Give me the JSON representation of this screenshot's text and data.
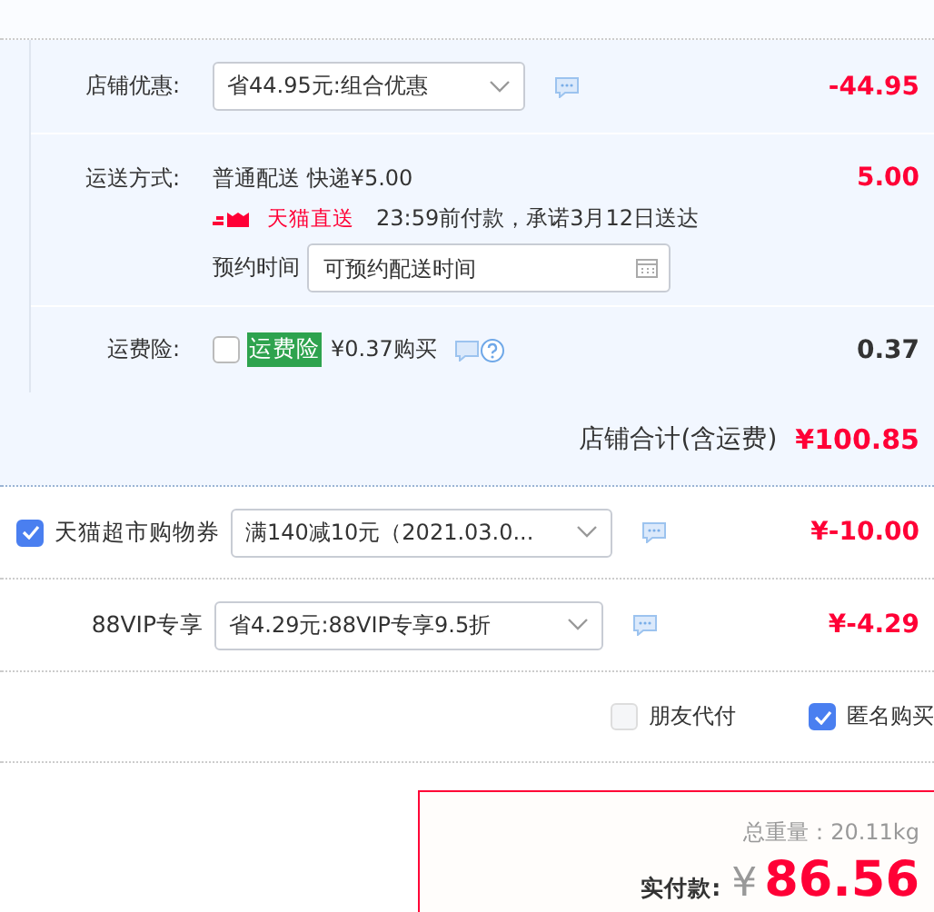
{
  "store_discount": {
    "label": "店铺优惠:",
    "select": "省44.95元:组合优惠",
    "amount": "-44.95"
  },
  "shipping": {
    "label": "运送方式:",
    "method": "普通配送 快递¥5.00",
    "badge": "天猫直送",
    "promise": "23:59前付款，承诺3月12日送达",
    "appointment_label": "预约时间",
    "appointment_placeholder": "可预约配送时间",
    "amount": "5.00"
  },
  "insurance": {
    "label": "运费险:",
    "checked": false,
    "tag": "运费险",
    "price": "¥0.37购买",
    "amount": "0.37"
  },
  "store_total": {
    "label": "店铺合计(含运费)",
    "amount": "¥100.85"
  },
  "coupons": [
    {
      "kind": "checkbox",
      "checked": true,
      "label": "天猫超市购物券",
      "select": "满140减10元（2021.03.0...",
      "amount": "¥-10.00"
    },
    {
      "kind": "plain",
      "label": "88VIP专享",
      "select": "省4.29元:88VIP专享9.5折",
      "amount": "¥-4.29"
    }
  ],
  "options": [
    {
      "label": "朋友代付",
      "checked": false
    },
    {
      "label": "匿名购买",
      "checked": true
    }
  ],
  "summary": {
    "weight": "总重量：20.11kg",
    "pay_label": "实付款:",
    "currency": "¥",
    "total": "86.56"
  }
}
